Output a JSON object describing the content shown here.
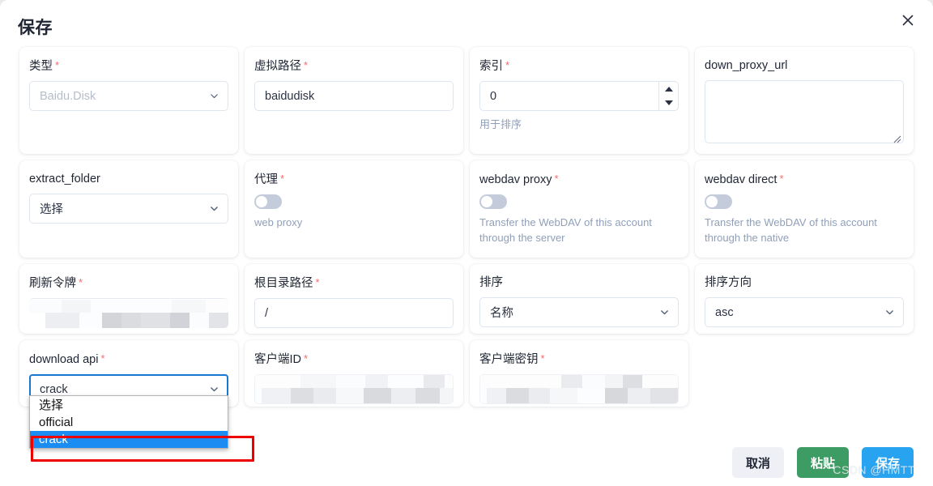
{
  "dialog": {
    "title": "保存",
    "close_icon": "close-icon"
  },
  "fields": {
    "type": {
      "label": "类型",
      "required": "*",
      "value": "Baidu.Disk"
    },
    "virtual_path": {
      "label": "虚拟路径",
      "required": "*",
      "value": "baidudisk"
    },
    "index": {
      "label": "索引",
      "required": "*",
      "value": "0",
      "hint": "用于排序"
    },
    "down_proxy_url": {
      "label": "down_proxy_url",
      "required": "",
      "value": ""
    },
    "extract_folder": {
      "label": "extract_folder",
      "required": "",
      "value": "选择"
    },
    "proxy": {
      "label": "代理",
      "required": "*",
      "hint": "web proxy",
      "state": "off"
    },
    "webdav_proxy": {
      "label": "webdav proxy",
      "required": "*",
      "hint": "Transfer the WebDAV of this account through the server",
      "state": "off"
    },
    "webdav_direct": {
      "label": "webdav direct",
      "required": "*",
      "hint": "Transfer the WebDAV of this account through the native",
      "state": "off"
    },
    "refresh_token": {
      "label": "刷新令牌",
      "required": "*",
      "value": ""
    },
    "root_folder_path": {
      "label": "根目录路径",
      "required": "*",
      "value": "/"
    },
    "order_by": {
      "label": "排序",
      "required": "",
      "value": "名称"
    },
    "order_direction": {
      "label": "排序方向",
      "required": "",
      "value": "asc"
    },
    "download_api": {
      "label": "download api",
      "required": "*",
      "value": "crack",
      "options": [
        "选择",
        "official",
        "crack"
      ],
      "selected_option": "crack"
    },
    "client_id": {
      "label": "客户端ID",
      "required": "*",
      "value": ""
    },
    "client_secret": {
      "label": "客户端密钥",
      "required": "*",
      "value": ""
    }
  },
  "footer": {
    "cancel_label": "取消",
    "paste_label": "粘贴",
    "save_label": "保存"
  },
  "watermark": "CSDN @HMTT",
  "colors": {
    "required_red": "#f56c6c",
    "annotation_red": "#ee0000",
    "highlight_blue": "#1b8cf2",
    "focus_blue": "#1878d1",
    "paste_green": "#3d9c63",
    "save_blue": "#28a3f0",
    "toggle_off": "#c4ccdb"
  }
}
